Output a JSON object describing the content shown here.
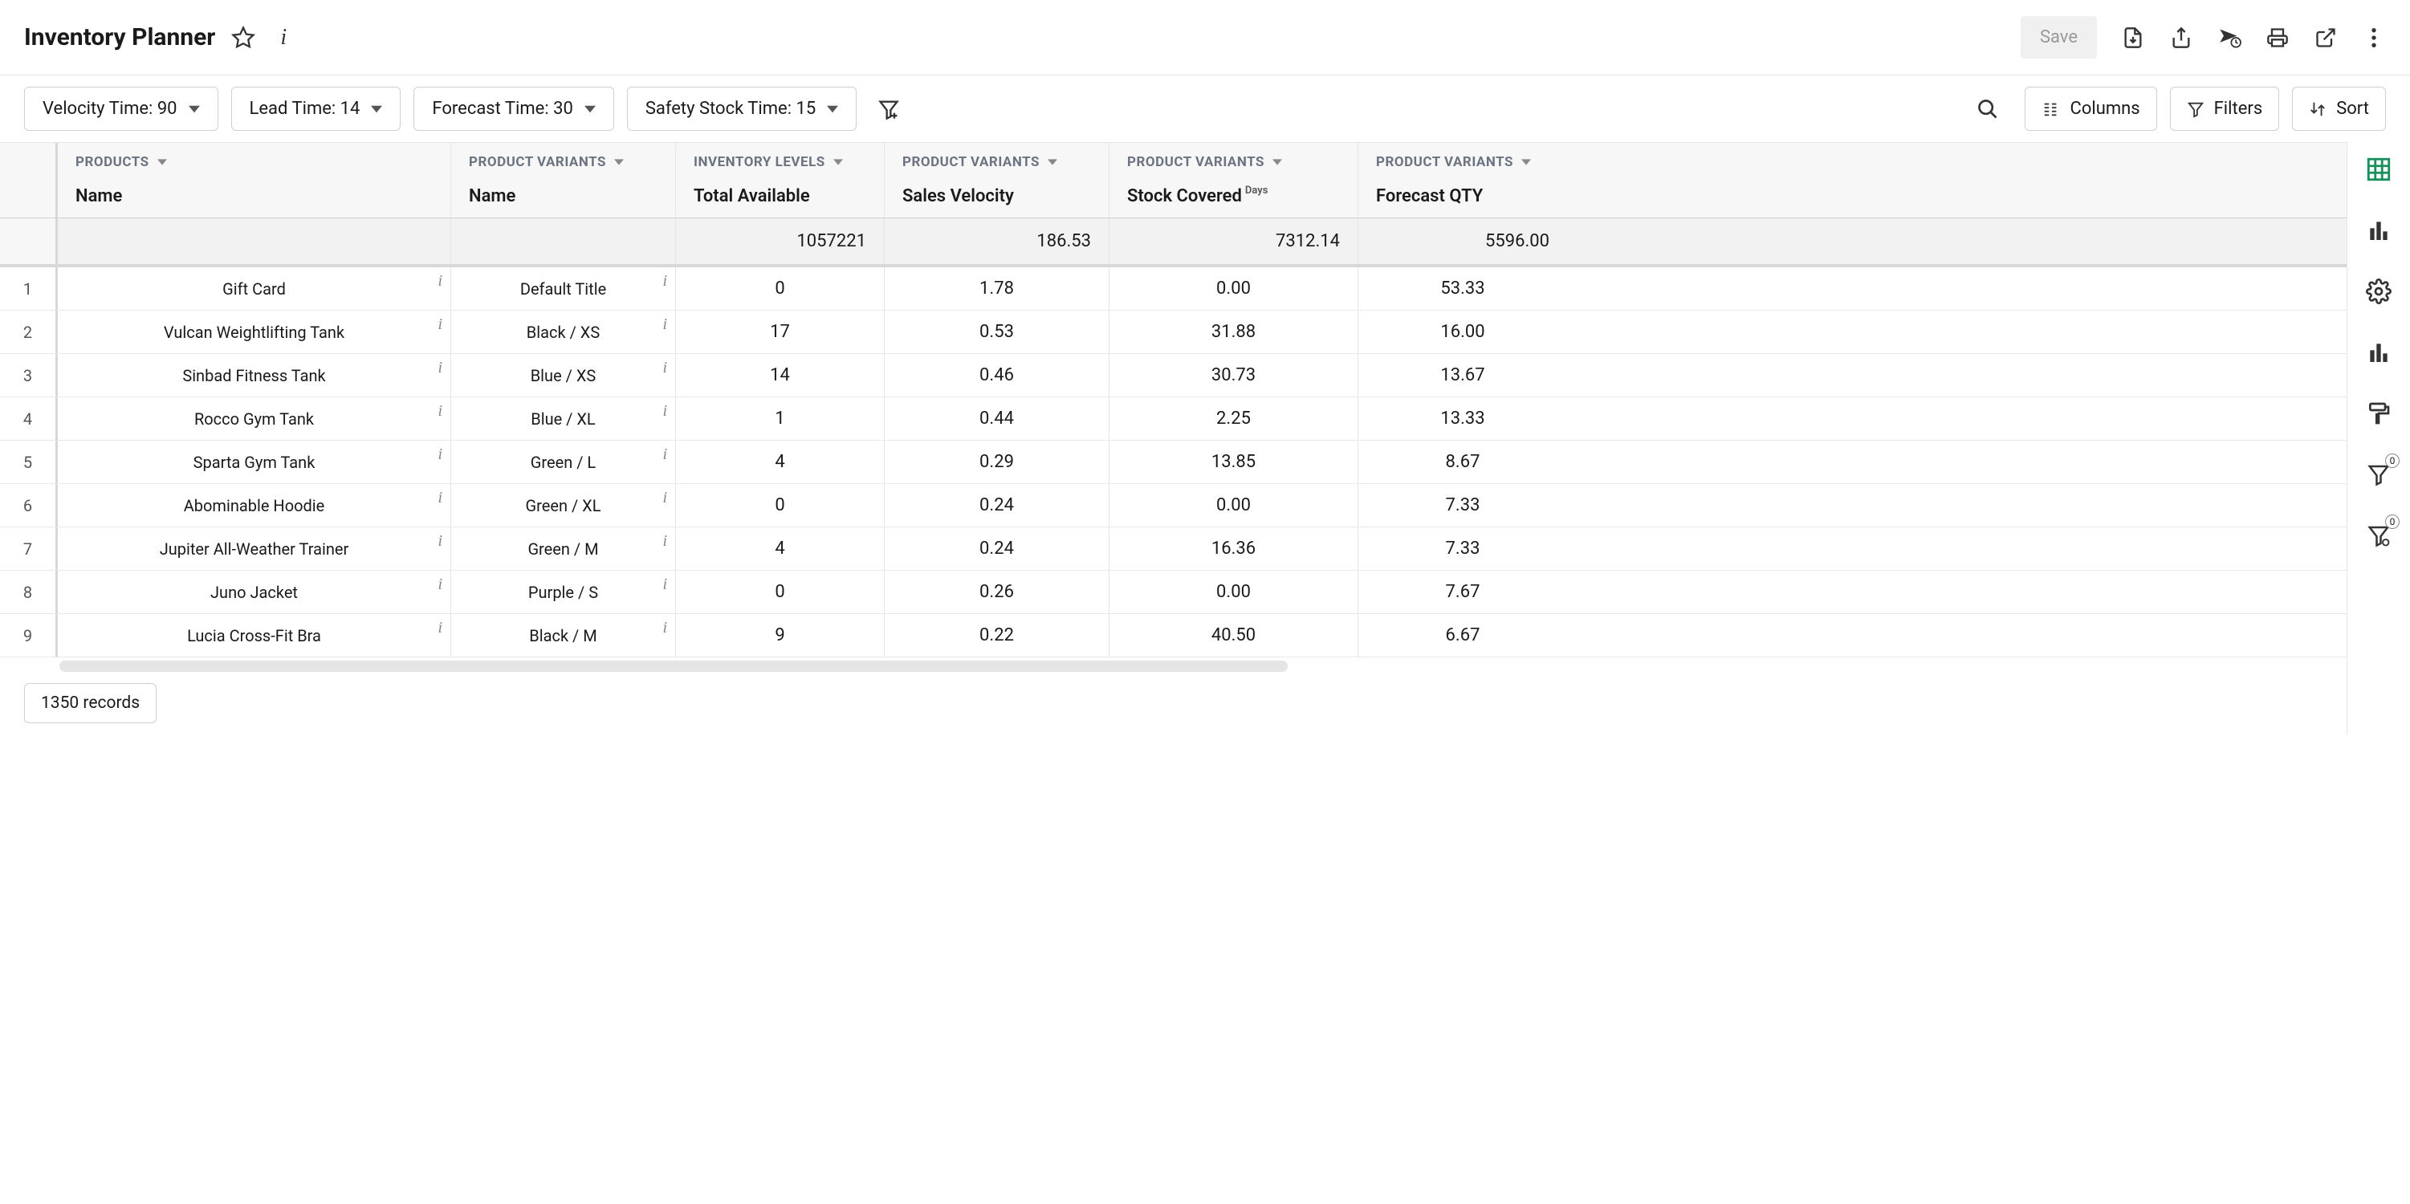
{
  "header": {
    "title": "Inventory Planner",
    "save_label": "Save"
  },
  "toolbar": {
    "velocity": "Velocity Time: 90",
    "lead": "Lead Time: 14",
    "forecast": "Forecast Time: 30",
    "safety": "Safety Stock Time: 15",
    "columns": "Columns",
    "filters": "Filters",
    "sort": "Sort"
  },
  "sidebar": {
    "filter_badge": "0",
    "config_badge": "0"
  },
  "columns_meta": {
    "c0_group": "PRODUCTS",
    "c0_field": "Name",
    "c1_group": "PRODUCT VARIANTS",
    "c1_field": "Name",
    "c2_group": "INVENTORY LEVELS",
    "c2_field": "Total Available",
    "c3_group": "PRODUCT VARIANTS",
    "c3_field": "Sales Velocity",
    "c4_group": "PRODUCT VARIANTS",
    "c4_field": "Stock Covered",
    "c4_sup": "Days",
    "c5_group": "PRODUCT VARIANTS",
    "c5_field": "Forecast QTY"
  },
  "summary": {
    "total_available": "1057221",
    "sales_velocity": "186.53",
    "stock_covered": "7312.14",
    "forecast_qty": "5596.00"
  },
  "rows": [
    {
      "product": "Gift Card",
      "variant": "Default Title",
      "avail": "0",
      "velocity": "1.78",
      "covered": "0.00",
      "forecast": "53.33"
    },
    {
      "product": "Vulcan Weightlifting Tank",
      "variant": "Black / XS",
      "avail": "17",
      "velocity": "0.53",
      "covered": "31.88",
      "forecast": "16.00"
    },
    {
      "product": "Sinbad Fitness Tank",
      "variant": "Blue / XS",
      "avail": "14",
      "velocity": "0.46",
      "covered": "30.73",
      "forecast": "13.67"
    },
    {
      "product": "Rocco Gym Tank",
      "variant": "Blue / XL",
      "avail": "1",
      "velocity": "0.44",
      "covered": "2.25",
      "forecast": "13.33"
    },
    {
      "product": "Sparta Gym Tank",
      "variant": "Green / L",
      "avail": "4",
      "velocity": "0.29",
      "covered": "13.85",
      "forecast": "8.67"
    },
    {
      "product": "Abominable Hoodie",
      "variant": "Green / XL",
      "avail": "0",
      "velocity": "0.24",
      "covered": "0.00",
      "forecast": "7.33"
    },
    {
      "product": "Jupiter All-Weather Trainer",
      "variant": "Green / M",
      "avail": "4",
      "velocity": "0.24",
      "covered": "16.36",
      "forecast": "7.33"
    },
    {
      "product": "Juno Jacket",
      "variant": "Purple / S",
      "avail": "0",
      "velocity": "0.26",
      "covered": "0.00",
      "forecast": "7.67"
    },
    {
      "product": "Lucia Cross-Fit Bra",
      "variant": "Black / M",
      "avail": "9",
      "velocity": "0.22",
      "covered": "40.50",
      "forecast": "6.67"
    }
  ],
  "footer": {
    "records": "1350 records"
  }
}
